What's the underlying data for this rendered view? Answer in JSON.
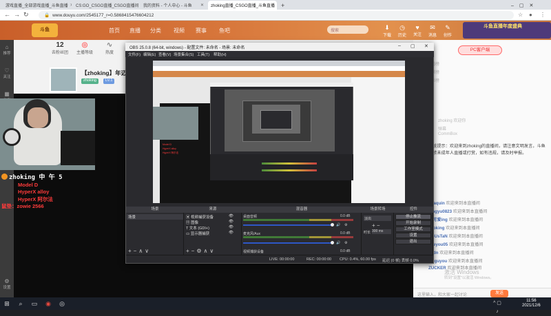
{
  "browser": {
    "tabs": [
      {
        "label": "游戏直播_全部游戏直播_斗鱼直播",
        "active": false
      },
      {
        "label": "CS:GO_CSGO直播_CSGO直播间 斗",
        "active": false
      },
      {
        "label": "我的资料 - 个人中心 - 斗鱼",
        "active": false
      },
      {
        "label": "zhoking直播_CSGO直播_斗鱼直播",
        "active": true
      }
    ],
    "new_tab": "+",
    "url": "www.douyu.com/2545177_r=0.5868415476604212"
  },
  "douyu": {
    "nav": [
      "首页",
      "直播",
      "分类",
      "视频",
      "赛事",
      "鱼吧"
    ],
    "search_placeholder": "搜索",
    "header_icons": [
      {
        "icon": "download-icon",
        "label": "下载"
      },
      {
        "icon": "history-icon",
        "label": "历史"
      },
      {
        "icon": "follow-icon",
        "label": "关注"
      },
      {
        "icon": "message-icon",
        "label": "消息"
      },
      {
        "icon": "create-icon",
        "label": "创作"
      }
    ],
    "promo": "斗鱼直播年度盛典"
  },
  "rail": [
    {
      "icon": "home-icon",
      "label": "推荐"
    },
    {
      "icon": "follow-icon",
      "label": "关注"
    },
    {
      "icon": "category-icon",
      "label": "分类"
    },
    {
      "icon": "video-icon",
      "label": "视频"
    },
    {
      "icon": "settings-icon",
      "label": "设置"
    }
  ],
  "room": {
    "stats": [
      {
        "value": "12",
        "label": "去粉丝团"
      },
      {
        "value": "",
        "label": "主播等级"
      },
      {
        "value": "",
        "label": "热度"
      }
    ],
    "title": "【zhoking】年迈的",
    "tags": [
      "zhoking",
      "LV.1"
    ],
    "stream_overlay": {
      "streamer": "zhoking 中 午 5",
      "lines": [
        "Model D",
        "HyperX alloy",
        "HyperX 阿尔法",
        "鼠垫：zowie 2566"
      ]
    }
  },
  "right_panel": {
    "pk_button": "PC客户端",
    "faint": [
      "主播榜",
      "贡献榜",
      "粉丝榜",
      "zhoking 欢迎你",
      "弹幕",
      "CommBox"
    ],
    "notice": "系统提示：欢迎来到zhoking的直播间，请注意文明发言，斗鱼严禁未成年人直播或打赏，如有违规，请及时举报。",
    "chats": [
      {
        "user": "Joaquin",
        "text": "欢迎来到本直播间"
      },
      {
        "user": "qingyu0823",
        "text": "欢迎来到本直播间"
      },
      {
        "user": "小可爱ing",
        "text": "欢迎来到本直播间"
      },
      {
        "user": "zhoking",
        "text": "欢迎来到本直播间"
      },
      {
        "user": "MeUsTaN",
        "text": "欢迎来到本直播间"
      },
      {
        "user": "zoeyou05",
        "text": "欢迎来到本直播间"
      },
      {
        "user": "ykdn",
        "text": "欢迎来到本直播间"
      },
      {
        "user": "zpiguyou",
        "text": "欢迎来到本直播间"
      },
      {
        "user": "ZUCKER",
        "text": "欢迎来到本直播间"
      }
    ],
    "windows_activation": [
      "激活 Windows",
      "转到\"设置\"以激活 Windows。"
    ],
    "chat_placeholder": "这里输入，和大家一起讨论",
    "send": "发送"
  },
  "obs": {
    "title": "OBS 25.0.8 (64-bit, windows) - 配置文件: 未命名 - 场景: 未命名",
    "menu": [
      "文件(F)",
      "编辑(E)",
      "查看(V)",
      "场景集合(S)",
      "工具(T)",
      "帮助(H)"
    ],
    "docks": {
      "scenes": {
        "header": "场景",
        "items": [
          "场景"
        ]
      },
      "sources": {
        "header": "来源",
        "items": [
          "视频捕获设备",
          "图像",
          "文本 (GDI+)",
          "显示器捕获"
        ]
      },
      "mixer": {
        "header": "混音器",
        "tracks": [
          {
            "name": "桌面音频",
            "db": "0.0 dB"
          },
          {
            "name": "麦克风/Aux",
            "db": "0.0 dB"
          },
          {
            "name": "视频捕获设备",
            "db": "0.0 dB"
          }
        ]
      },
      "transitions": {
        "header": "场景转场",
        "type": "淡出",
        "duration_label": "时长",
        "duration": "300 ms"
      },
      "controls": {
        "header": "控件",
        "buttons": [
          "停止推流",
          "开始录制",
          "工作室模式",
          "设置",
          "退出"
        ]
      }
    },
    "status": {
      "live": "LIVE: 00:00:00",
      "rec": "REC: 00:00:00",
      "cpu": "CPU: 0.4%, 60.00 fps",
      "dropped": "延迟 (0 帧) 丢帧 0.0%"
    }
  },
  "taskbar": {
    "time": "11:56",
    "date": "2021/12/6"
  }
}
